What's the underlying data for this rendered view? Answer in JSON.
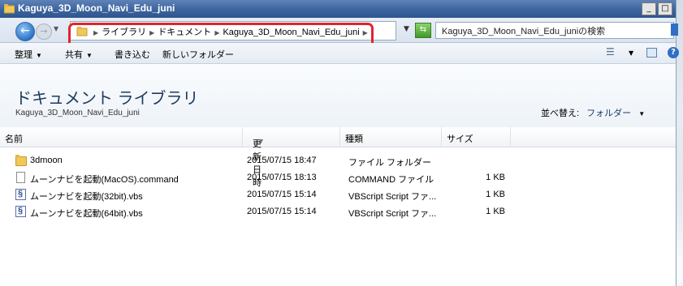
{
  "window": {
    "title": "Kaguya_3D_Moon_Navi_Edu_juni",
    "buttons": {
      "minimize": "_",
      "maximize": "□"
    }
  },
  "address": {
    "crumbs": [
      "ライブラリ",
      "ドキュメント",
      "Kaguya_3D_Moon_Navi_Edu_juni"
    ],
    "search_text": "Kaguya_3D_Moon_Navi_Edu_juniの検索"
  },
  "toolbar": {
    "organize": "整理",
    "share": "共有",
    "burn": "書き込む",
    "new_folder": "新しいフォルダー"
  },
  "library": {
    "title": "ドキュメント ライブラリ",
    "subtitle": "Kaguya_3D_Moon_Navi_Edu_juni",
    "arrange_label": "並べ替え:",
    "arrange_value": "フォルダー"
  },
  "columns": {
    "name": "名前",
    "date": "更新日時",
    "type": "種類",
    "size": "サイズ"
  },
  "files": [
    {
      "icon": "folder-icon",
      "name": "3dmoon",
      "date": "2015/07/15 18:47",
      "type": "ファイル フォルダー",
      "size": ""
    },
    {
      "icon": "file-icon",
      "name": "ムーンナビを起動(MacOS).command",
      "date": "2015/07/15 18:13",
      "type": "COMMAND ファイル",
      "size": "1 KB"
    },
    {
      "icon": "vbs-icon",
      "name": "ムーンナビを起動(32bit).vbs",
      "date": "2015/07/15 15:14",
      "type": "VBScript Script ファ...",
      "size": "1 KB"
    },
    {
      "icon": "vbs-icon",
      "name": "ムーンナビを起動(64bit).vbs",
      "date": "2015/07/15 15:14",
      "type": "VBScript Script ファ...",
      "size": "1 KB"
    }
  ],
  "colors": {
    "highlight": "#e2232e",
    "titlebar": "#3c649e"
  }
}
